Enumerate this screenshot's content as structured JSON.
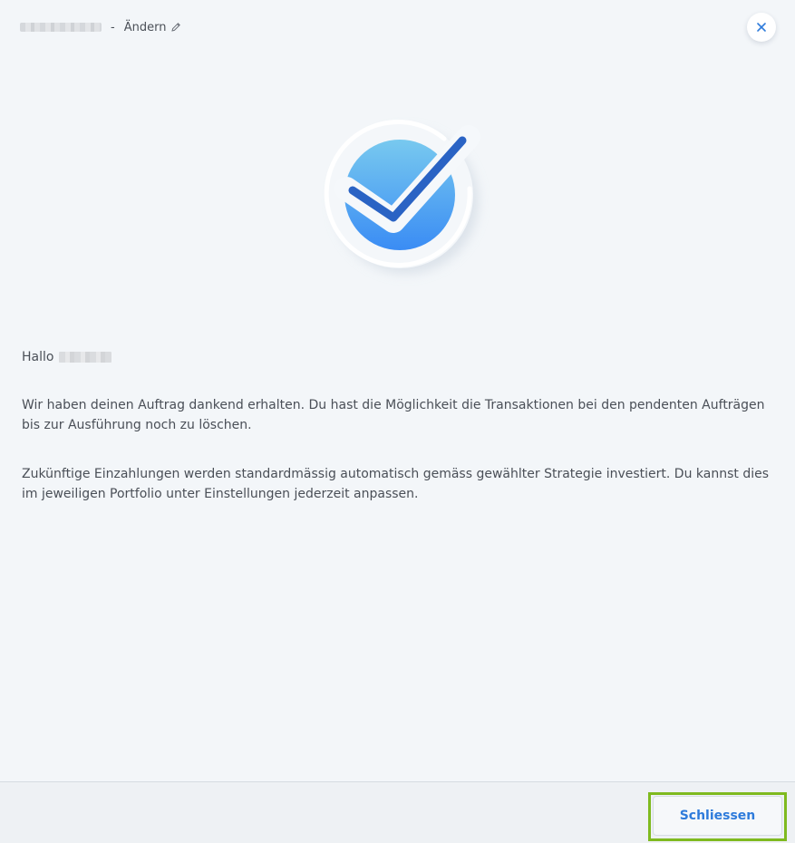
{
  "header": {
    "separator": "-",
    "edit_label": "Ändern",
    "edit_icon": "pencil-icon",
    "close_icon": "close-icon"
  },
  "illustration": {
    "icon": "checkmark-success-icon"
  },
  "content": {
    "greeting": "Hallo",
    "paragraph1": "Wir haben deinen Auftrag dankend erhalten. Du hast die Möglichkeit die Transaktionen bei den pendenten Aufträgen bis zur Ausführung noch zu löschen.",
    "paragraph2": "Zukünftige Einzahlungen werden standardmässig automatisch gemäss gewählter Strategie investiert. Du kannst dies im jeweiligen Portfolio unter Einstellungen jederzeit anpassen."
  },
  "footer": {
    "close_button_label": "Schliessen"
  },
  "colors": {
    "accent": "#2e7bdb",
    "highlight_outline": "#7fba1f",
    "background": "#f3f6f9"
  }
}
